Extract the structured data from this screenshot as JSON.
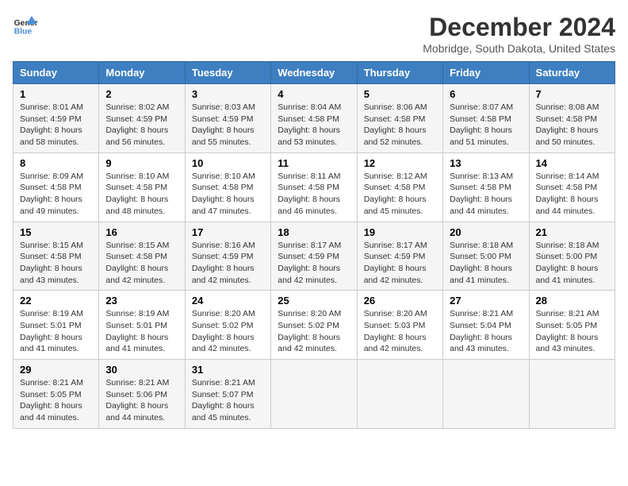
{
  "header": {
    "logo_line1": "General",
    "logo_line2": "Blue",
    "title": "December 2024",
    "subtitle": "Mobridge, South Dakota, United States"
  },
  "columns": [
    "Sunday",
    "Monday",
    "Tuesday",
    "Wednesday",
    "Thursday",
    "Friday",
    "Saturday"
  ],
  "weeks": [
    [
      {
        "day": "1",
        "sunrise": "Sunrise: 8:01 AM",
        "sunset": "Sunset: 4:59 PM",
        "daylight": "Daylight: 8 hours and 58 minutes."
      },
      {
        "day": "2",
        "sunrise": "Sunrise: 8:02 AM",
        "sunset": "Sunset: 4:59 PM",
        "daylight": "Daylight: 8 hours and 56 minutes."
      },
      {
        "day": "3",
        "sunrise": "Sunrise: 8:03 AM",
        "sunset": "Sunset: 4:59 PM",
        "daylight": "Daylight: 8 hours and 55 minutes."
      },
      {
        "day": "4",
        "sunrise": "Sunrise: 8:04 AM",
        "sunset": "Sunset: 4:58 PM",
        "daylight": "Daylight: 8 hours and 53 minutes."
      },
      {
        "day": "5",
        "sunrise": "Sunrise: 8:06 AM",
        "sunset": "Sunset: 4:58 PM",
        "daylight": "Daylight: 8 hours and 52 minutes."
      },
      {
        "day": "6",
        "sunrise": "Sunrise: 8:07 AM",
        "sunset": "Sunset: 4:58 PM",
        "daylight": "Daylight: 8 hours and 51 minutes."
      },
      {
        "day": "7",
        "sunrise": "Sunrise: 8:08 AM",
        "sunset": "Sunset: 4:58 PM",
        "daylight": "Daylight: 8 hours and 50 minutes."
      }
    ],
    [
      {
        "day": "8",
        "sunrise": "Sunrise: 8:09 AM",
        "sunset": "Sunset: 4:58 PM",
        "daylight": "Daylight: 8 hours and 49 minutes."
      },
      {
        "day": "9",
        "sunrise": "Sunrise: 8:10 AM",
        "sunset": "Sunset: 4:58 PM",
        "daylight": "Daylight: 8 hours and 48 minutes."
      },
      {
        "day": "10",
        "sunrise": "Sunrise: 8:10 AM",
        "sunset": "Sunset: 4:58 PM",
        "daylight": "Daylight: 8 hours and 47 minutes."
      },
      {
        "day": "11",
        "sunrise": "Sunrise: 8:11 AM",
        "sunset": "Sunset: 4:58 PM",
        "daylight": "Daylight: 8 hours and 46 minutes."
      },
      {
        "day": "12",
        "sunrise": "Sunrise: 8:12 AM",
        "sunset": "Sunset: 4:58 PM",
        "daylight": "Daylight: 8 hours and 45 minutes."
      },
      {
        "day": "13",
        "sunrise": "Sunrise: 8:13 AM",
        "sunset": "Sunset: 4:58 PM",
        "daylight": "Daylight: 8 hours and 44 minutes."
      },
      {
        "day": "14",
        "sunrise": "Sunrise: 8:14 AM",
        "sunset": "Sunset: 4:58 PM",
        "daylight": "Daylight: 8 hours and 44 minutes."
      }
    ],
    [
      {
        "day": "15",
        "sunrise": "Sunrise: 8:15 AM",
        "sunset": "Sunset: 4:58 PM",
        "daylight": "Daylight: 8 hours and 43 minutes."
      },
      {
        "day": "16",
        "sunrise": "Sunrise: 8:15 AM",
        "sunset": "Sunset: 4:58 PM",
        "daylight": "Daylight: 8 hours and 42 minutes."
      },
      {
        "day": "17",
        "sunrise": "Sunrise: 8:16 AM",
        "sunset": "Sunset: 4:59 PM",
        "daylight": "Daylight: 8 hours and 42 minutes."
      },
      {
        "day": "18",
        "sunrise": "Sunrise: 8:17 AM",
        "sunset": "Sunset: 4:59 PM",
        "daylight": "Daylight: 8 hours and 42 minutes."
      },
      {
        "day": "19",
        "sunrise": "Sunrise: 8:17 AM",
        "sunset": "Sunset: 4:59 PM",
        "daylight": "Daylight: 8 hours and 42 minutes."
      },
      {
        "day": "20",
        "sunrise": "Sunrise: 8:18 AM",
        "sunset": "Sunset: 5:00 PM",
        "daylight": "Daylight: 8 hours and 41 minutes."
      },
      {
        "day": "21",
        "sunrise": "Sunrise: 8:18 AM",
        "sunset": "Sunset: 5:00 PM",
        "daylight": "Daylight: 8 hours and 41 minutes."
      }
    ],
    [
      {
        "day": "22",
        "sunrise": "Sunrise: 8:19 AM",
        "sunset": "Sunset: 5:01 PM",
        "daylight": "Daylight: 8 hours and 41 minutes."
      },
      {
        "day": "23",
        "sunrise": "Sunrise: 8:19 AM",
        "sunset": "Sunset: 5:01 PM",
        "daylight": "Daylight: 8 hours and 41 minutes."
      },
      {
        "day": "24",
        "sunrise": "Sunrise: 8:20 AM",
        "sunset": "Sunset: 5:02 PM",
        "daylight": "Daylight: 8 hours and 42 minutes."
      },
      {
        "day": "25",
        "sunrise": "Sunrise: 8:20 AM",
        "sunset": "Sunset: 5:02 PM",
        "daylight": "Daylight: 8 hours and 42 minutes."
      },
      {
        "day": "26",
        "sunrise": "Sunrise: 8:20 AM",
        "sunset": "Sunset: 5:03 PM",
        "daylight": "Daylight: 8 hours and 42 minutes."
      },
      {
        "day": "27",
        "sunrise": "Sunrise: 8:21 AM",
        "sunset": "Sunset: 5:04 PM",
        "daylight": "Daylight: 8 hours and 43 minutes."
      },
      {
        "day": "28",
        "sunrise": "Sunrise: 8:21 AM",
        "sunset": "Sunset: 5:05 PM",
        "daylight": "Daylight: 8 hours and 43 minutes."
      }
    ],
    [
      {
        "day": "29",
        "sunrise": "Sunrise: 8:21 AM",
        "sunset": "Sunset: 5:05 PM",
        "daylight": "Daylight: 8 hours and 44 minutes."
      },
      {
        "day": "30",
        "sunrise": "Sunrise: 8:21 AM",
        "sunset": "Sunset: 5:06 PM",
        "daylight": "Daylight: 8 hours and 44 minutes."
      },
      {
        "day": "31",
        "sunrise": "Sunrise: 8:21 AM",
        "sunset": "Sunset: 5:07 PM",
        "daylight": "Daylight: 8 hours and 45 minutes."
      },
      null,
      null,
      null,
      null
    ]
  ]
}
